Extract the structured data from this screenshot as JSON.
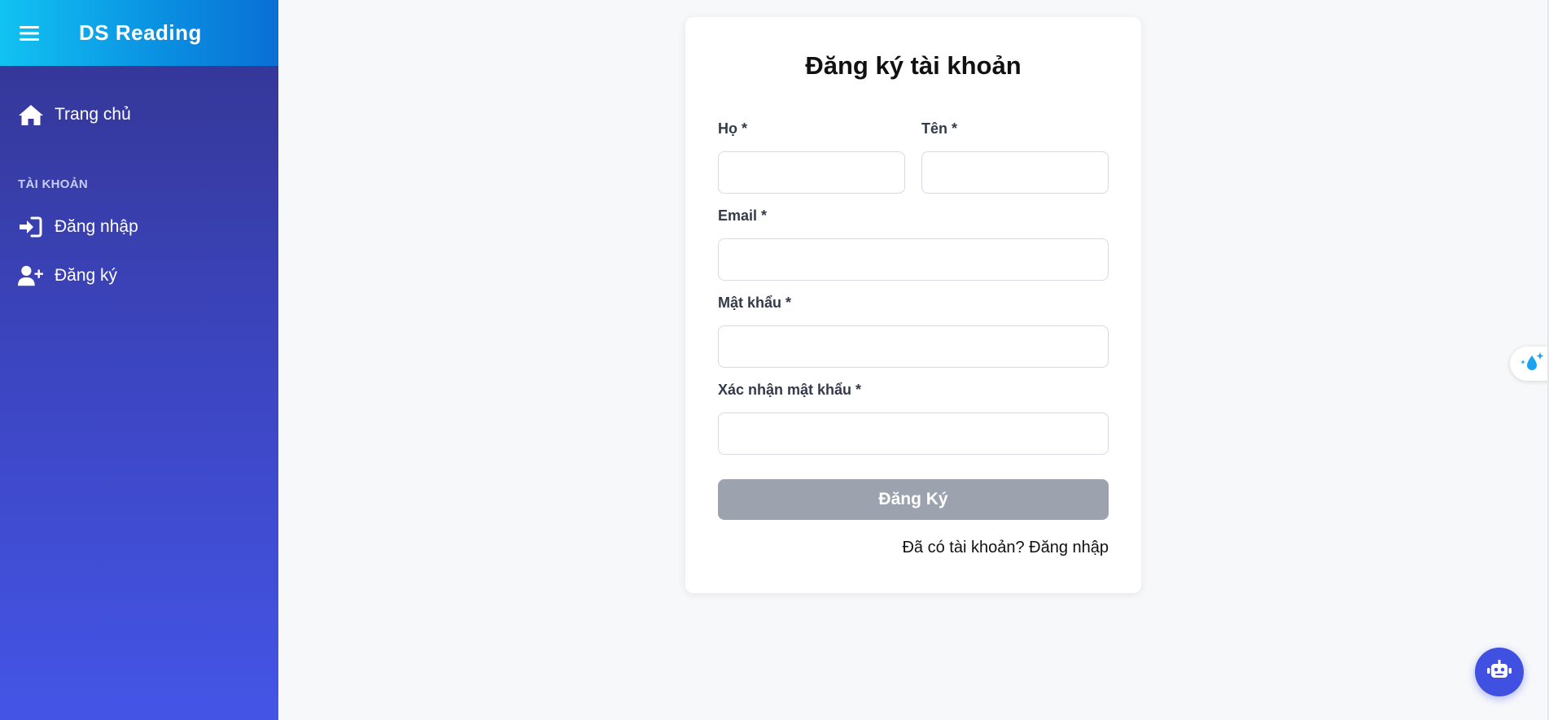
{
  "sidebar": {
    "brand": "DS Reading",
    "home_label": "Trang chủ",
    "section_label": "TÀI KHOẢN",
    "login_label": "Đăng nhập",
    "register_label": "Đăng ký"
  },
  "form": {
    "title": "Đăng ký tài khoản",
    "last_name_label": "Họ *",
    "first_name_label": "Tên *",
    "email_label": "Email *",
    "password_label": "Mật khẩu *",
    "confirm_password_label": "Xác nhận mật khẩu *",
    "last_name_value": "",
    "first_name_value": "",
    "email_value": "",
    "password_value": "",
    "confirm_password_value": "",
    "submit_label": "Đăng Ký",
    "login_prompt": "Đã có tài khoản? Đăng nhập"
  },
  "icons": {
    "menu": "hamburger-menu-icon",
    "home": "home-icon",
    "login": "sign-in-icon",
    "register": "user-plus-icon",
    "floating_tool": "water-drop-sparkle-icon",
    "chat": "robot-icon"
  },
  "colors": {
    "sidebar_top": "#333590",
    "sidebar_bottom": "#4455e6",
    "header_start": "#12c3f2",
    "header_end": "#0a6fd6",
    "submit_disabled": "#9ca3af",
    "chat_button": "#4050e0"
  }
}
